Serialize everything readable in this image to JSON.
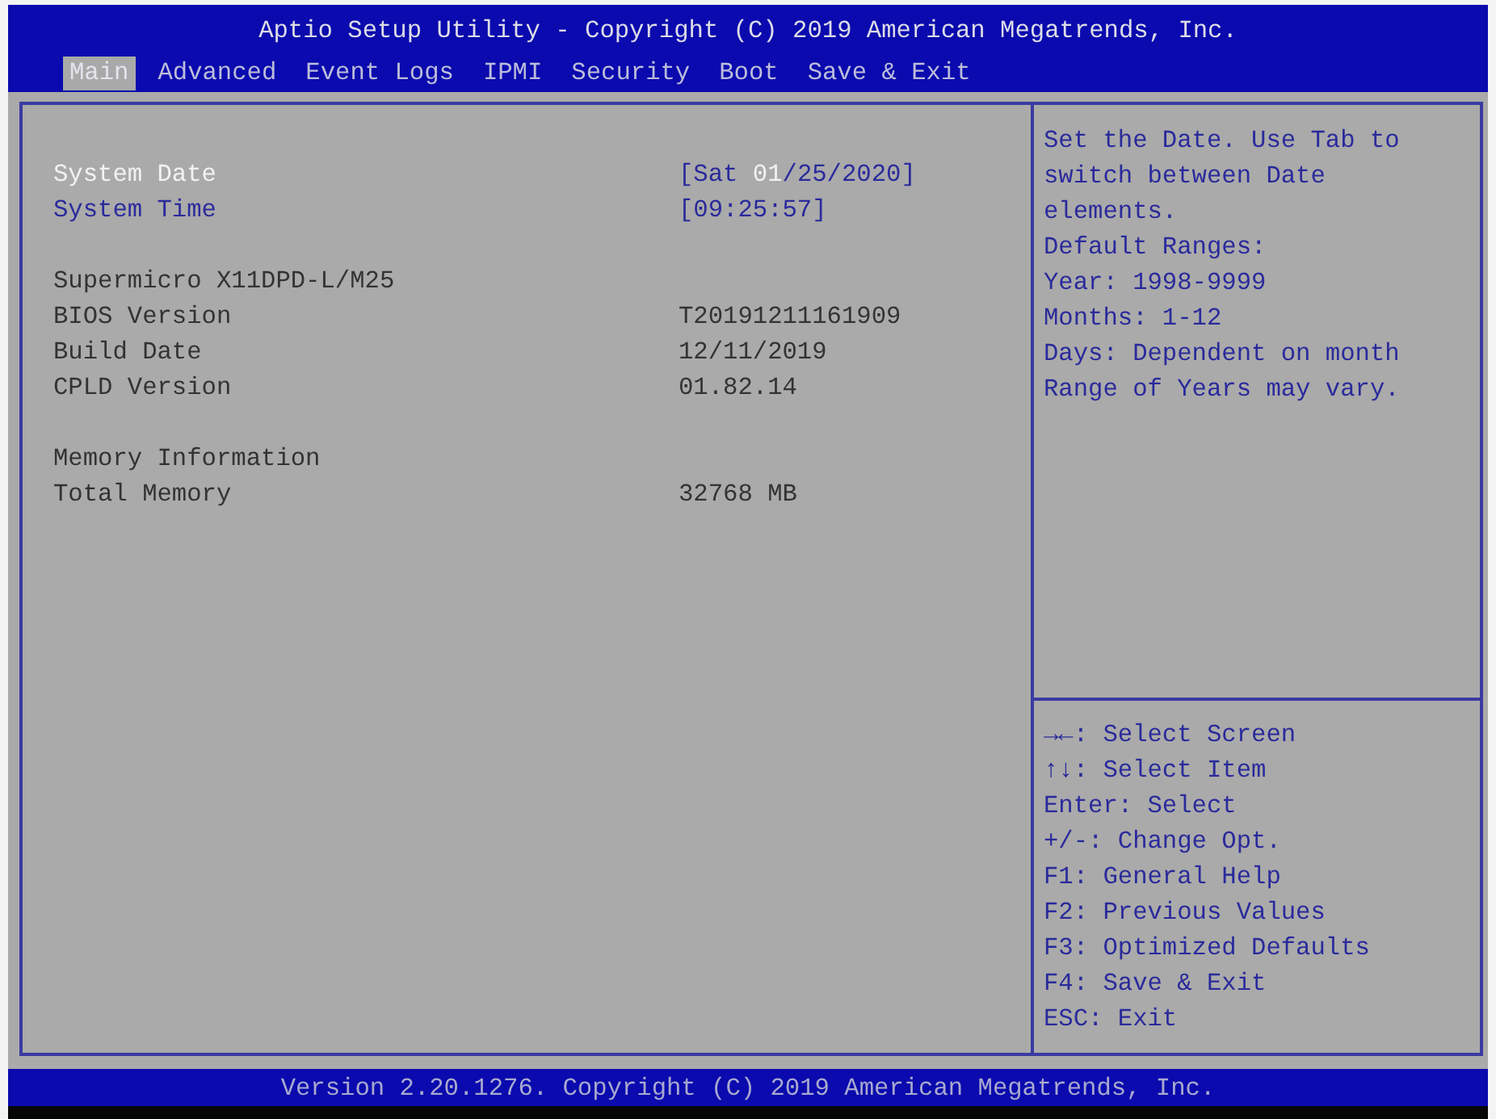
{
  "title": "Aptio Setup Utility - Copyright (C) 2019 American Megatrends, Inc.",
  "tabs": [
    {
      "label": "Main",
      "selected": true
    },
    {
      "label": "Advanced",
      "selected": false
    },
    {
      "label": "Event Logs",
      "selected": false
    },
    {
      "label": "IPMI",
      "selected": false
    },
    {
      "label": "Security",
      "selected": false
    },
    {
      "label": "Boot",
      "selected": false
    },
    {
      "label": "Save & Exit",
      "selected": false
    }
  ],
  "sections": [
    {
      "rows": [
        {
          "kind": "setting",
          "label": "System Date",
          "selected": true,
          "value_parts": [
            {
              "text": "[Sat ",
              "selected": false
            },
            {
              "text": "01",
              "selected": true
            },
            {
              "text": "/25/2020]",
              "selected": false
            }
          ]
        },
        {
          "kind": "setting",
          "label": "System Time",
          "selected": false,
          "value_parts": [
            {
              "text": "[09:25:57]",
              "selected": false
            }
          ]
        }
      ]
    },
    {
      "rows": [
        {
          "kind": "info",
          "label": "Supermicro X11DPD-L/M25"
        },
        {
          "kind": "info",
          "label": "BIOS Version",
          "value": "T20191211161909"
        },
        {
          "kind": "info",
          "label": "Build Date",
          "value": "12/11/2019"
        },
        {
          "kind": "info",
          "label": "CPLD Version",
          "value": "01.82.14"
        }
      ]
    },
    {
      "rows": [
        {
          "kind": "info",
          "label": "Memory Information"
        },
        {
          "kind": "info",
          "label": "Total Memory",
          "value": "32768 MB"
        }
      ]
    }
  ],
  "help": [
    "Set the Date. Use Tab to switch between Date elements.",
    "Default Ranges:",
    "Year: 1998-9999",
    "Months: 1-12",
    "Days: Dependent on month",
    "Range of Years may vary."
  ],
  "key_help": [
    "→←: Select Screen",
    "↑↓: Select Item",
    "Enter: Select",
    "+/-: Change Opt.",
    "F1: General Help",
    "F2: Previous Values",
    "F3: Optimized Defaults",
    "F4: Save & Exit",
    "ESC: Exit"
  ],
  "status_bar": "Version 2.20.1276. Copyright (C) 2019 American Megatrends, Inc."
}
